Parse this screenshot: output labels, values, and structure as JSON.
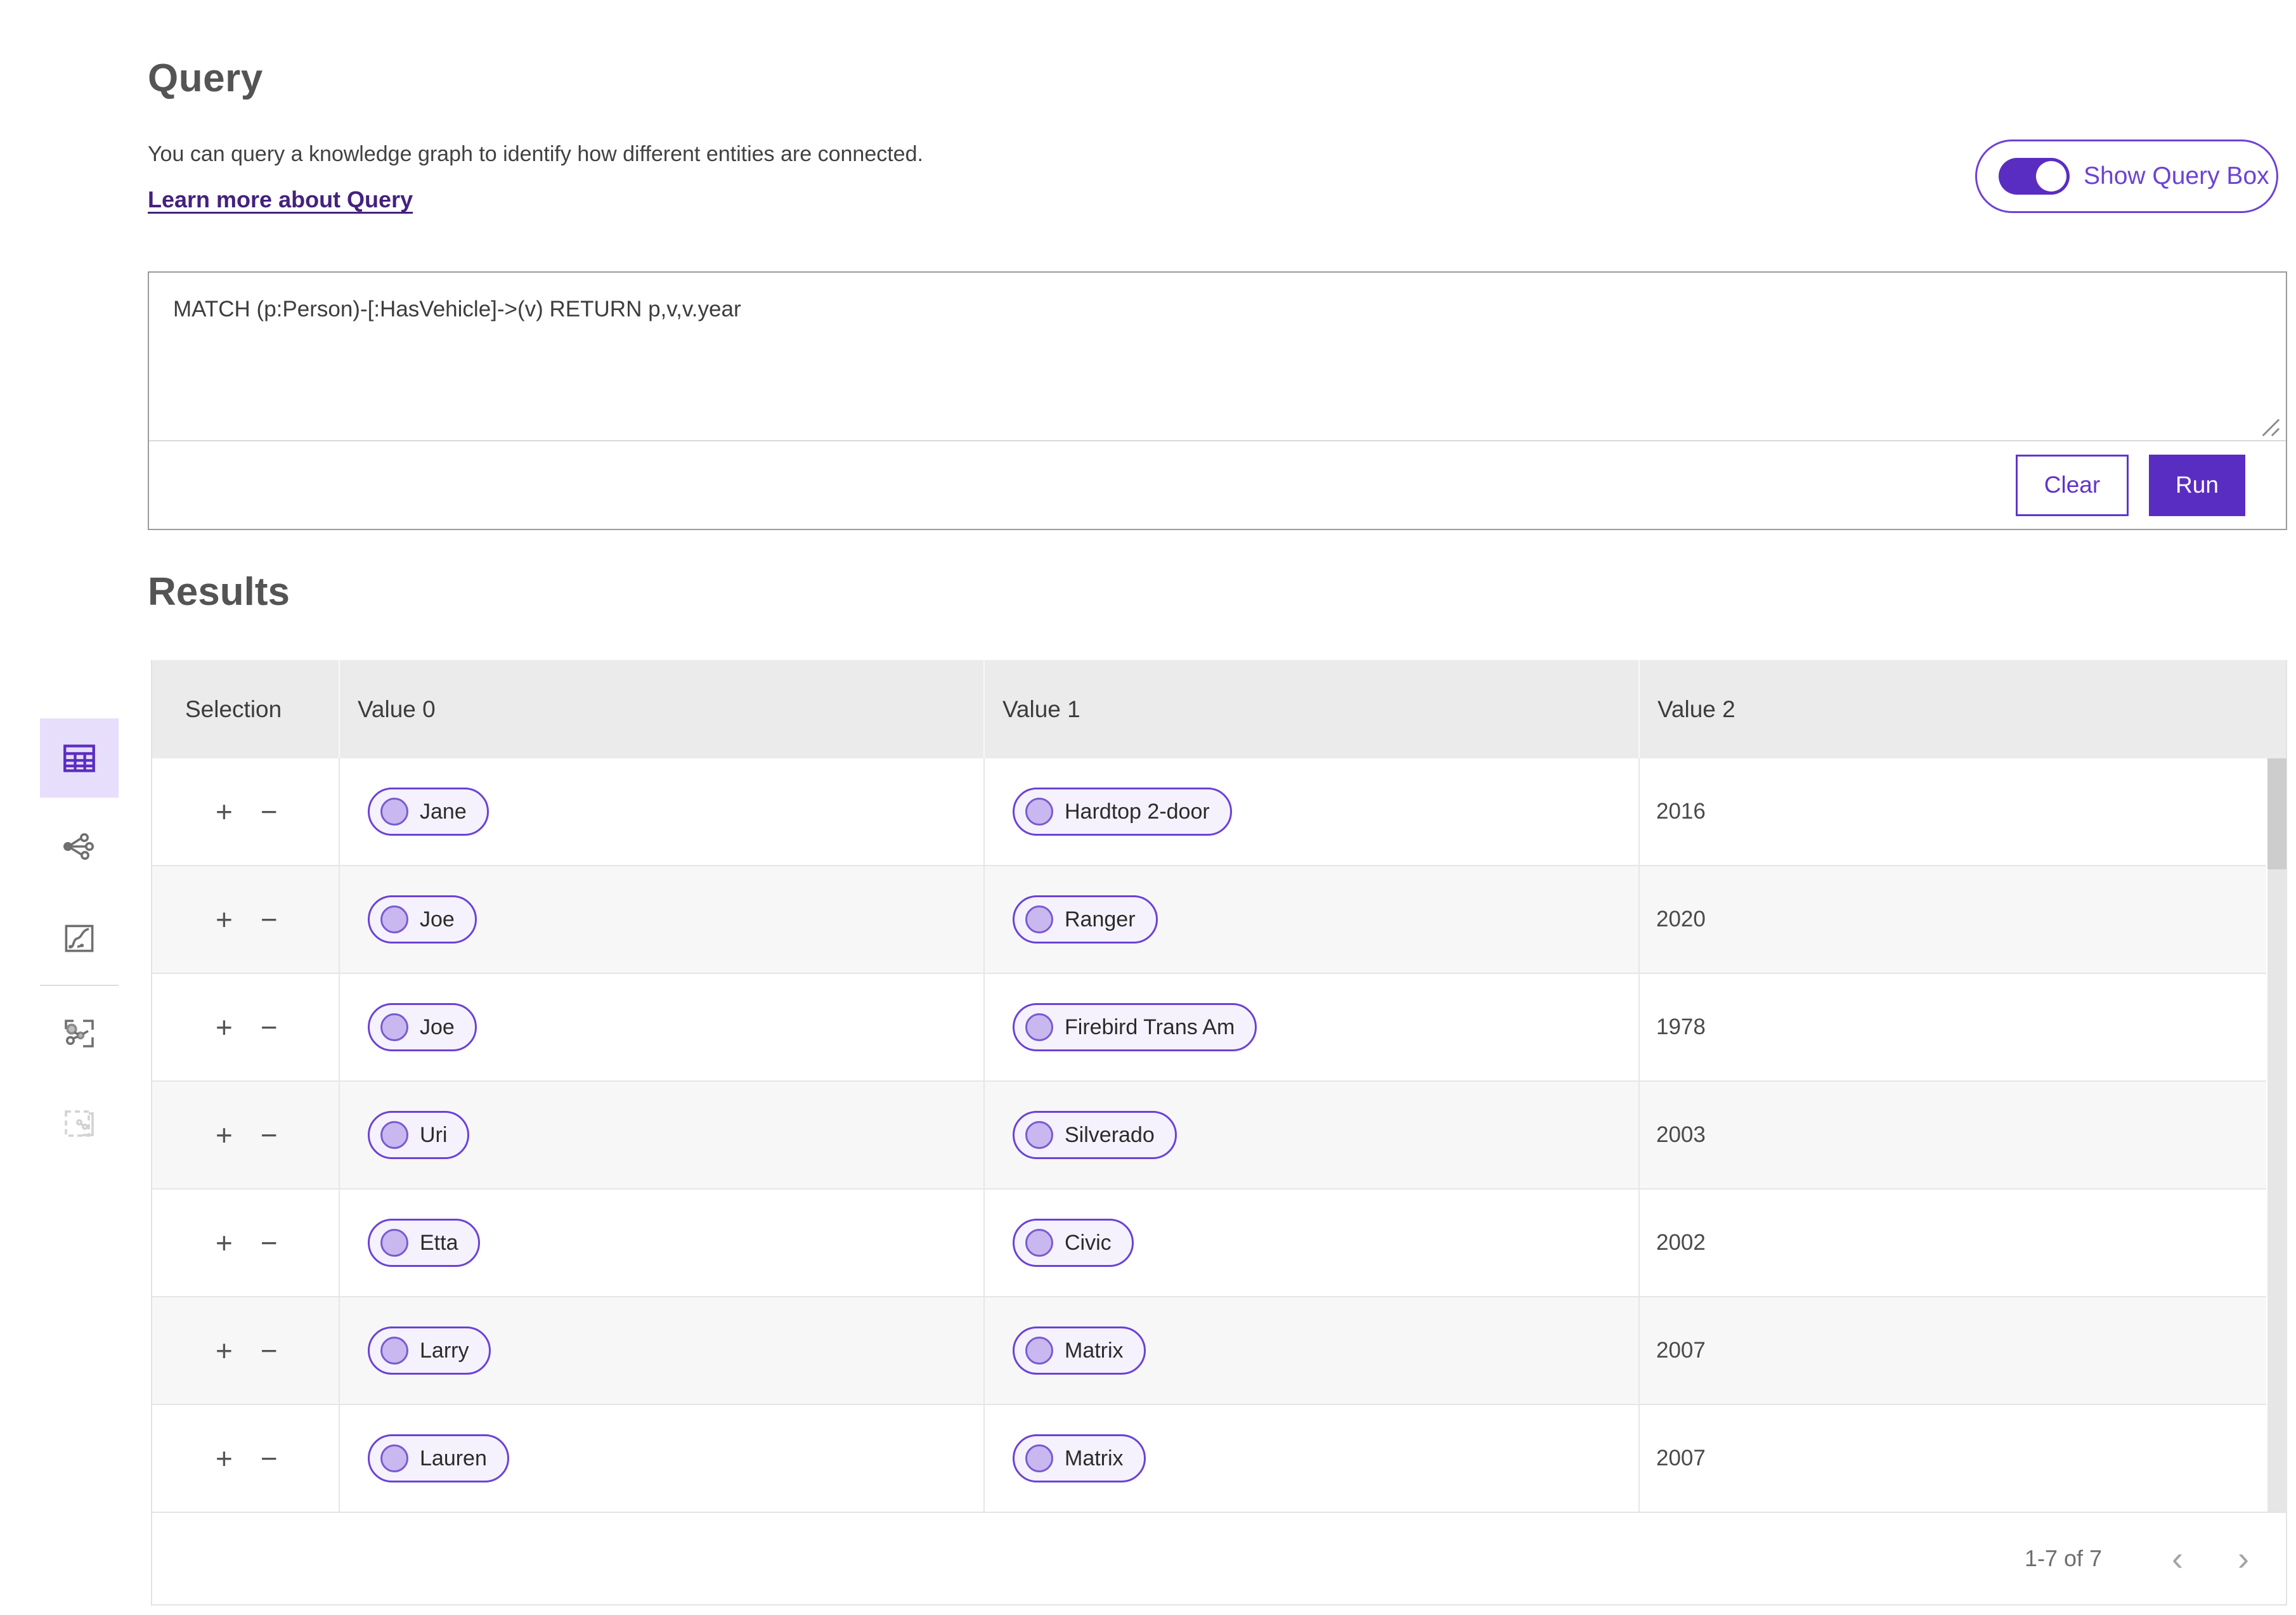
{
  "colors": {
    "accent": "#5a2dc2",
    "accent_border": "#6c42d6",
    "link": "#44217e",
    "pill_bg": "#f5f2fd",
    "node_fill": "#c9b8ef",
    "active_sidebar_bg": "#e7defc",
    "table_header_bg": "#ebebeb"
  },
  "sidebar": {
    "items": [
      {
        "icon": "table-icon",
        "active": true
      },
      {
        "icon": "network-icon",
        "active": false
      },
      {
        "icon": "route-icon",
        "active": false
      },
      {
        "icon": "graph-expand-icon",
        "active": false
      },
      {
        "icon": "dashed-selection-icon",
        "active": false,
        "disabled": true
      }
    ]
  },
  "query_section": {
    "title": "Query",
    "description": "You can query a knowledge graph to identify how different entities are connected.",
    "learn_more_link": "Learn more about Query",
    "toggle_label": "Show Query Box",
    "query_text": "MATCH (p:Person)-[:HasVehicle]->(v) RETURN p,v,v.year",
    "clear_button": "Clear",
    "run_button": "Run"
  },
  "results_section": {
    "title": "Results",
    "columns": [
      "Selection",
      "Value 0",
      "Value 1",
      "Value 2"
    ],
    "selection_controls": {
      "add": "+",
      "remove": "−"
    },
    "rows": [
      {
        "person": "Jane",
        "vehicle": "Hardtop 2-door",
        "year": "2016"
      },
      {
        "person": "Joe",
        "vehicle": "Ranger",
        "year": "2020"
      },
      {
        "person": "Joe",
        "vehicle": "Firebird Trans Am",
        "year": "1978"
      },
      {
        "person": "Uri",
        "vehicle": "Silverado",
        "year": "2003"
      },
      {
        "person": "Etta",
        "vehicle": "Civic",
        "year": "2002"
      },
      {
        "person": "Larry",
        "vehicle": "Matrix",
        "year": "2007"
      },
      {
        "person": "Lauren",
        "vehicle": "Matrix",
        "year": "2007"
      }
    ],
    "pagination": {
      "range_label": "1-7 of 7",
      "prev": "‹",
      "next": "›"
    }
  }
}
